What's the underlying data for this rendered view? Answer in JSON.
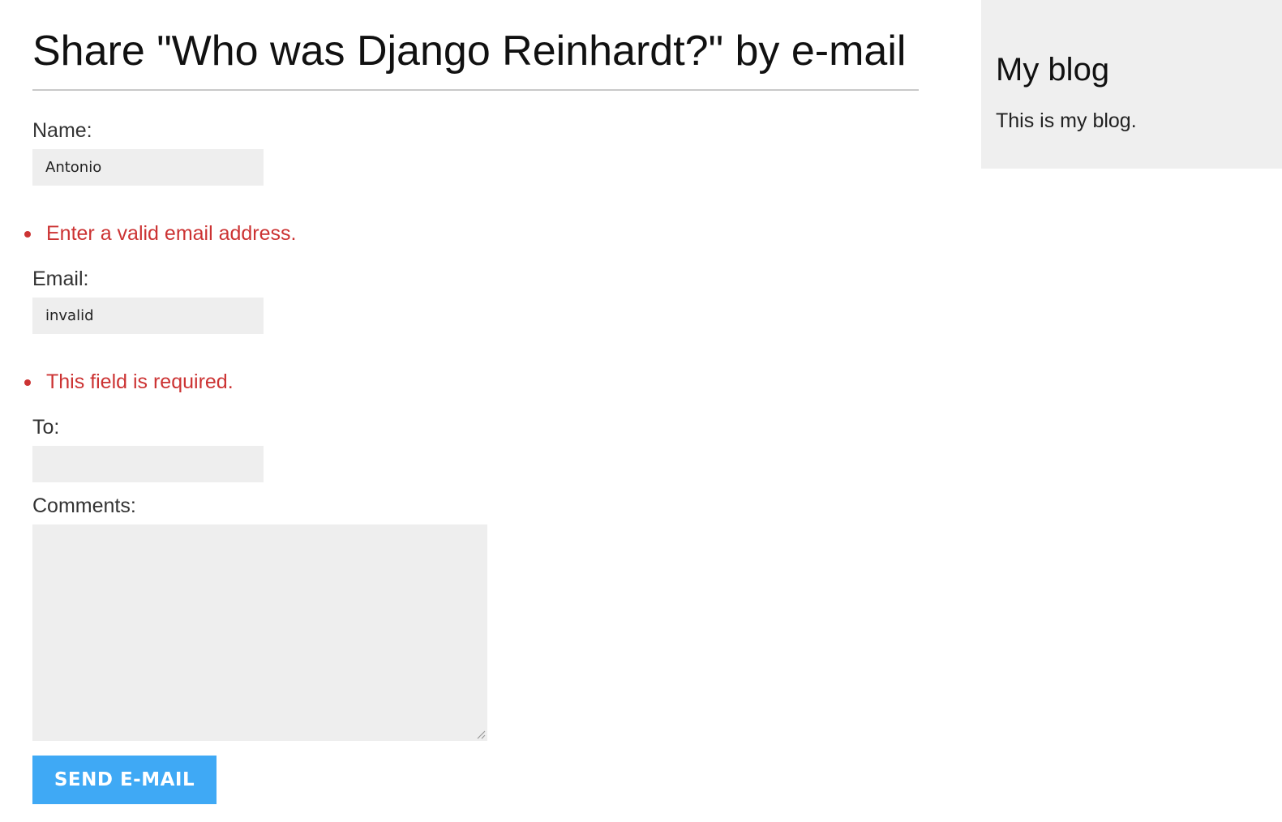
{
  "page": {
    "title": "Share \"Who was Django Reinhardt?\" by e-mail"
  },
  "form": {
    "name": {
      "label": "Name:",
      "value": "Antonio"
    },
    "email": {
      "error": "Enter a valid email address.",
      "label": "Email:",
      "value": "invalid"
    },
    "to": {
      "error": "This field is required.",
      "label": "To:",
      "value": ""
    },
    "comments": {
      "label": "Comments:",
      "value": ""
    },
    "submit_label": "SEND E-MAIL"
  },
  "sidebar": {
    "title": "My blog",
    "text": "This is my blog."
  },
  "colors": {
    "error": "#cc3333",
    "button": "#3fa9f5",
    "input_bg": "#eeeeee",
    "sidebar_bg": "#efefef"
  },
  "icons": {
    "resize": "resize-handle-icon"
  }
}
